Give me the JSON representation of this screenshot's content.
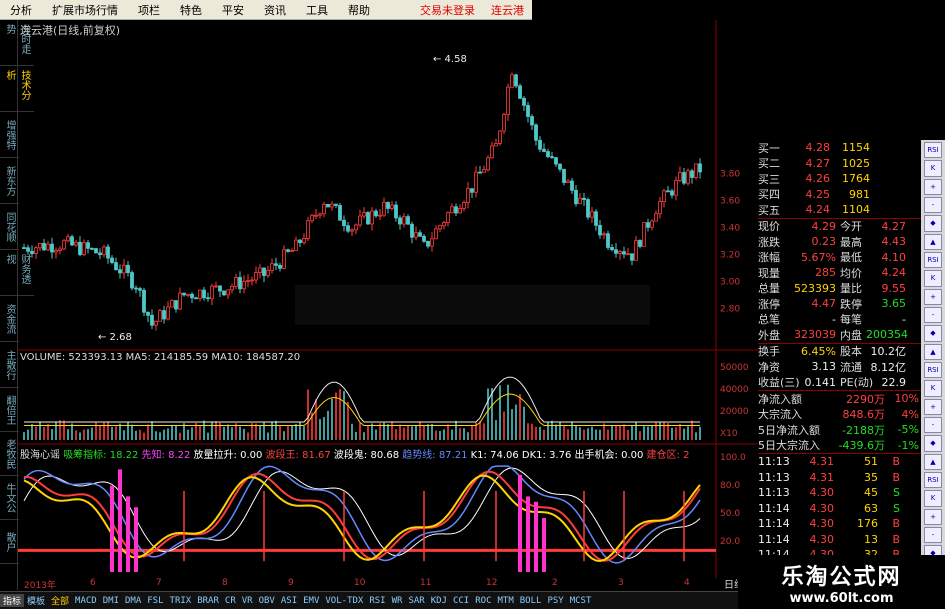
{
  "menu": {
    "items": [
      "分析",
      "扩展市场行情",
      "项栏",
      "特色",
      "平安",
      "资讯",
      "工具",
      "帮助"
    ],
    "login": "交易未登录",
    "stock_link": "连云港"
  },
  "chart": {
    "title": "连云港(日线,前复权)",
    "high_label": "4.58",
    "low_label": "2.68",
    "volume_text": "VOLUME: 523393.13  MA5: 214185.59  MA10: 184587.20",
    "indicator": {
      "name": "股海心谣",
      "items": [
        {
          "label": "吸筹指标:",
          "value": "18.22",
          "color": "#22dd22"
        },
        {
          "label": "先知:",
          "value": "8.22",
          "color": "#ff44ff"
        },
        {
          "label": "放量拉升:",
          "value": "0.00",
          "color": "#ffffff"
        },
        {
          "label": "波段王:",
          "value": "81.67",
          "color": "#ff4040"
        },
        {
          "label": "波段鬼:",
          "value": "80.68",
          "color": "#ffffff"
        },
        {
          "label": "趋势线:",
          "value": "87.21",
          "color": "#6688ff"
        },
        {
          "label": "K1:",
          "value": "74.06",
          "color": "#ffffff"
        },
        {
          "label": "DK1:",
          "value": "3.76",
          "color": "#ffffff"
        },
        {
          "label": "出手机会:",
          "value": "0.00",
          "color": "#ffffff"
        },
        {
          "label": "建仓区:",
          "value": "2",
          "color": "#ff4040"
        }
      ]
    },
    "price_axis": [
      "3.80",
      "3.60",
      "3.40",
      "3.20",
      "3.00",
      "2.80"
    ],
    "vol_axis": [
      "50000",
      "40000",
      "20000",
      "X10"
    ],
    "ind_axis": [
      "100.0",
      "80.0",
      "50.0",
      "20.0"
    ],
    "dates": [
      "2013年",
      "6",
      "7",
      "8",
      "9",
      "10",
      "11",
      "12",
      "2",
      "3",
      "4"
    ],
    "period_label": "日线"
  },
  "quote": {
    "bids": [
      {
        "label": "买一",
        "price": "4.28",
        "vol": "1154"
      },
      {
        "label": "买二",
        "price": "4.27",
        "vol": "1025"
      },
      {
        "label": "买三",
        "price": "4.26",
        "vol": "1764"
      },
      {
        "label": "买四",
        "price": "4.25",
        "vol": "981"
      },
      {
        "label": "买五",
        "price": "4.24",
        "vol": "1104"
      }
    ],
    "stats": [
      {
        "k1": "现价",
        "v1": "4.29",
        "c1": "red",
        "k2": "今开",
        "v2": "4.27",
        "c2": "red"
      },
      {
        "k1": "涨跌",
        "v1": "0.23",
        "c1": "red",
        "k2": "最高",
        "v2": "4.43",
        "c2": "red"
      },
      {
        "k1": "涨幅",
        "v1": "5.67%",
        "c1": "red",
        "k2": "最低",
        "v2": "4.10",
        "c2": "red"
      },
      {
        "k1": "现量",
        "v1": "285",
        "c1": "red",
        "k2": "均价",
        "v2": "4.24",
        "c2": "red"
      },
      {
        "k1": "总量",
        "v1": "523393",
        "c1": "yellow",
        "k2": "量比",
        "v2": "9.55",
        "c2": "red"
      },
      {
        "k1": "涨停",
        "v1": "4.47",
        "c1": "red",
        "k2": "跌停",
        "v2": "3.65",
        "c2": "green"
      },
      {
        "k1": "总笔",
        "v1": "-",
        "c1": "white",
        "k2": "每笔",
        "v2": "-",
        "c2": "white"
      },
      {
        "k1": "外盘",
        "v1": "323039",
        "c1": "red",
        "k2": "内盘",
        "v2": "200354",
        "c2": "green"
      }
    ],
    "stats2": [
      {
        "k1": "换手",
        "v1": "6.45%",
        "c1": "yellow",
        "k2": "股本",
        "v2": "10.2亿",
        "c2": "white"
      },
      {
        "k1": "净资",
        "v1": "3.13",
        "c1": "white",
        "k2": "流通",
        "v2": "8.12亿",
        "c2": "white"
      },
      {
        "k1": "收益(三)",
        "v1": "0.141",
        "c1": "white",
        "k2": "PE(动)",
        "v2": "22.9",
        "c2": "white"
      }
    ],
    "flows": [
      {
        "label": "净流入额",
        "value": "2290万",
        "pct": "10%",
        "c": "red"
      },
      {
        "label": "大宗流入",
        "value": "848.6万",
        "pct": "4%",
        "c": "red"
      },
      {
        "label": "5日净流入额",
        "value": "-2188万",
        "pct": "-5%",
        "c": "green"
      },
      {
        "label": "5日大宗流入",
        "value": "-439.6万",
        "pct": "-1%",
        "c": "green"
      }
    ],
    "ticks": [
      {
        "time": "11:13",
        "price": "4.31",
        "vol": "51",
        "bs": "B"
      },
      {
        "time": "11:13",
        "price": "4.31",
        "vol": "35",
        "bs": "B"
      },
      {
        "time": "11:13",
        "price": "4.30",
        "vol": "45",
        "bs": "S"
      },
      {
        "time": "11:14",
        "price": "4.30",
        "vol": "63",
        "bs": "S"
      },
      {
        "time": "11:14",
        "price": "4.30",
        "vol": "176",
        "bs": "B"
      },
      {
        "time": "11:14",
        "price": "4.30",
        "vol": "13",
        "bs": "B"
      },
      {
        "time": "11:14",
        "price": "4.30",
        "vol": "32",
        "bs": "B"
      }
    ]
  },
  "right_axis": [
    "3.80",
    "3.60",
    "3.40",
    "3.20",
    "3.00",
    "2.80"
  ],
  "sidetabs": [
    "分时走势",
    "技术分析",
    "增强特",
    "新东方",
    "同花顺",
    "财务透视",
    "资金流",
    "主散行",
    "翻倍王",
    "老牧民",
    "牛文公",
    "散户"
  ],
  "bottom_tabs": [
    "指标",
    "模板",
    "全部",
    "MACD",
    "DMI",
    "DMA",
    "FSL",
    "TRIX",
    "BRAR",
    "CR",
    "VR",
    "OBV",
    "ASI",
    "EMV",
    "VOL-TDX",
    "RSI",
    "WR",
    "SAR",
    "KDJ",
    "CCI",
    "ROC",
    "MTM",
    "BOLL",
    "PSY",
    "MCST"
  ],
  "toolbar_icons": [
    "RSI",
    "K",
    "+",
    "-",
    "◆",
    "▲"
  ],
  "logo": {
    "line1": "乐淘公式网",
    "line2": "www.60lt.com"
  }
}
